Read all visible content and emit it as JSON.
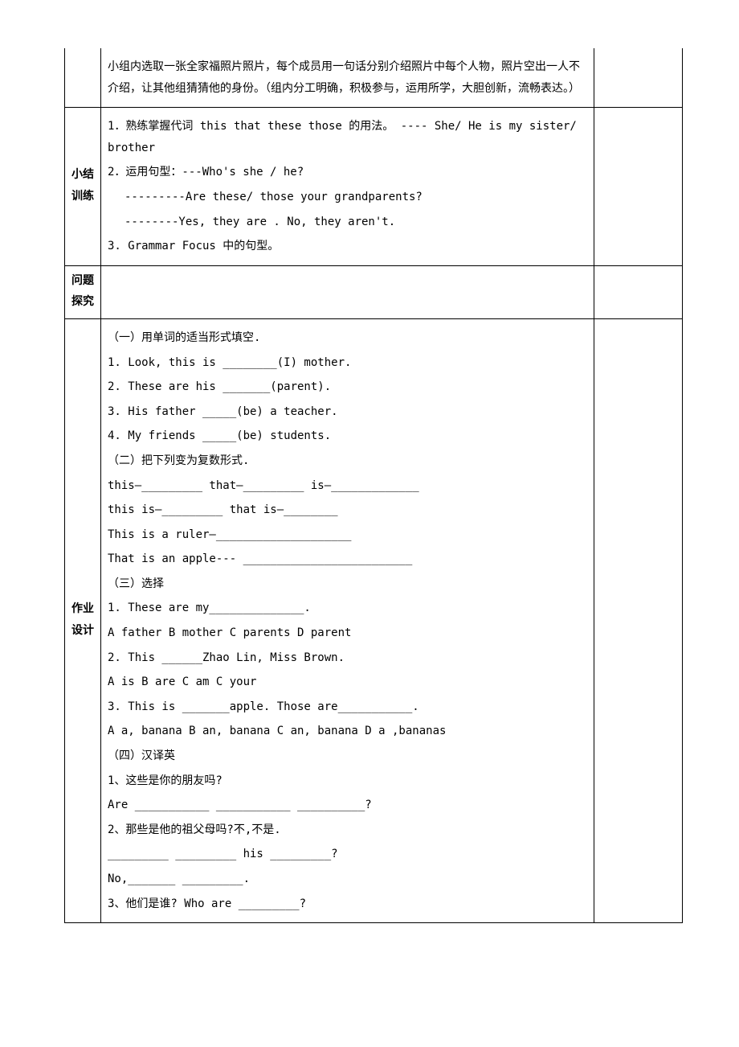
{
  "rows": {
    "r0": {
      "label": "",
      "content": [
        "小组内选取一张全家福照片照片，每个成员用一句话分别介绍照片中每个人物，照片空出一人不介绍，让其他组猜猜他的身份。（组内分工明确，积极参与，运用所学，大胆创新，流畅表达。）"
      ]
    },
    "r1": {
      "label": "小结训练",
      "content": [
        "1．熟练掌握代词 this  that  these  those 的用法。 ---- She/ He is my sister/ brother",
        "2．运用句型：---Who's she / he?",
        "      ---------Are these/ those your grandparents?",
        "      --------Yes, they are .  No, they aren't.",
        "3. Grammar Focus 中的句型。"
      ]
    },
    "r2": {
      "label": "问题探究",
      "content": [
        ""
      ]
    },
    "r3": {
      "label": "作业设计",
      "content": [
        "（一）用单词的适当形式填空.",
        "1. Look, this is ________(I) mother.",
        "2. These are his _______(parent).",
        "3. His father _____(be) a teacher.",
        "4. My friends _____(be) students.",
        "（二）把下列变为复数形式.",
        "this—_________   that—_________  is—_____________",
        "this is—_________  that  is—________",
        "This is a ruler—____________________",
        "That is an apple--- _________________________",
        "（三）选择",
        "1. These are my______________.",
        "  A father B mother C parents D parent",
        "2. This ______Zhao Lin, Miss Brown.",
        "  A is  B are  C am  C your",
        "3. This is _______apple.  Those  are___________.",
        "    A a, banana  B an, banana C an, banana  D a ,bananas",
        "（四）汉译英",
        "1、这些是你的朋友吗?",
        "Are ___________ ___________ __________?",
        "2、那些是他的祖父母吗?不,不是.",
        "_________ _________ his _________?",
        "No,_______ _________.",
        "3、他们是谁?  Who  are  _________?"
      ]
    }
  }
}
